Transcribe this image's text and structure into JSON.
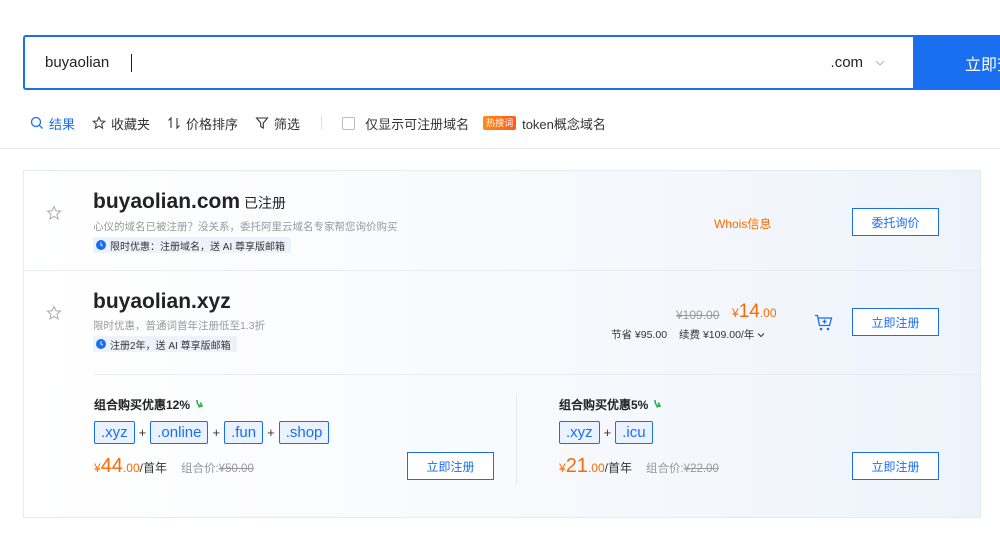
{
  "search": {
    "value": "buyaolian",
    "tld": ".com",
    "button_label": "立即查询"
  },
  "toolbar": {
    "results": "结果",
    "favorites": "收藏夹",
    "price_sort": "价格排序",
    "filter": "筛选",
    "only_available": "仅显示可注册域名",
    "hot_badge": "热搜词",
    "token_domains": "token概念域名"
  },
  "results": [
    {
      "domain": "buyaolian.com",
      "status": "已注册",
      "subtitle": "心仪的域名已被注册？没关系，委托阿里云域名专家帮您询价购买",
      "promo": "限时优惠：注册域名，送 AI 尊享版邮箱",
      "whois": "Whois信息",
      "action": "委托询价"
    },
    {
      "domain": "buyaolian.xyz",
      "subtitle": "限时优惠，普通词首年注册低至1.3折",
      "promo": "注册2年，送 AI 尊享版邮箱",
      "original_price": "¥109.00",
      "price_currency": "¥",
      "price_int": "14",
      "price_dec": ".00",
      "save_label": "节省 ¥95.00",
      "renew_label": "续费 ¥109.00/年",
      "action": "立即注册"
    }
  ],
  "bundles": [
    {
      "title": "组合购买优惠12%",
      "chips": [
        ".xyz",
        ".online",
        ".fun",
        ".shop"
      ],
      "currency": "¥",
      "price_int": "44",
      "price_dec": ".00",
      "unit": "/首年",
      "combo_label": "组合价: ",
      "combo_price": "¥50.00",
      "action": "立即注册"
    },
    {
      "title": "组合购买优惠5%",
      "chips": [
        ".xyz",
        ".icu"
      ],
      "currency": "¥",
      "price_int": "21",
      "price_dec": ".00",
      "unit": "/首年",
      "combo_label": "组合价: ",
      "combo_price": "¥22.00",
      "action": "立即注册"
    }
  ],
  "colors": {
    "accent": "#1a6ef0",
    "price": "#ff6a00",
    "discount_arrow": "#2bb24c"
  },
  "icons": {
    "search": "search-icon",
    "star": "star-icon",
    "sort": "sort-icon",
    "filter": "filter-icon",
    "clock": "clock-icon",
    "cart": "cart-icon",
    "chevron": "chevron-down-icon",
    "arrow": "arrow-down-icon"
  }
}
